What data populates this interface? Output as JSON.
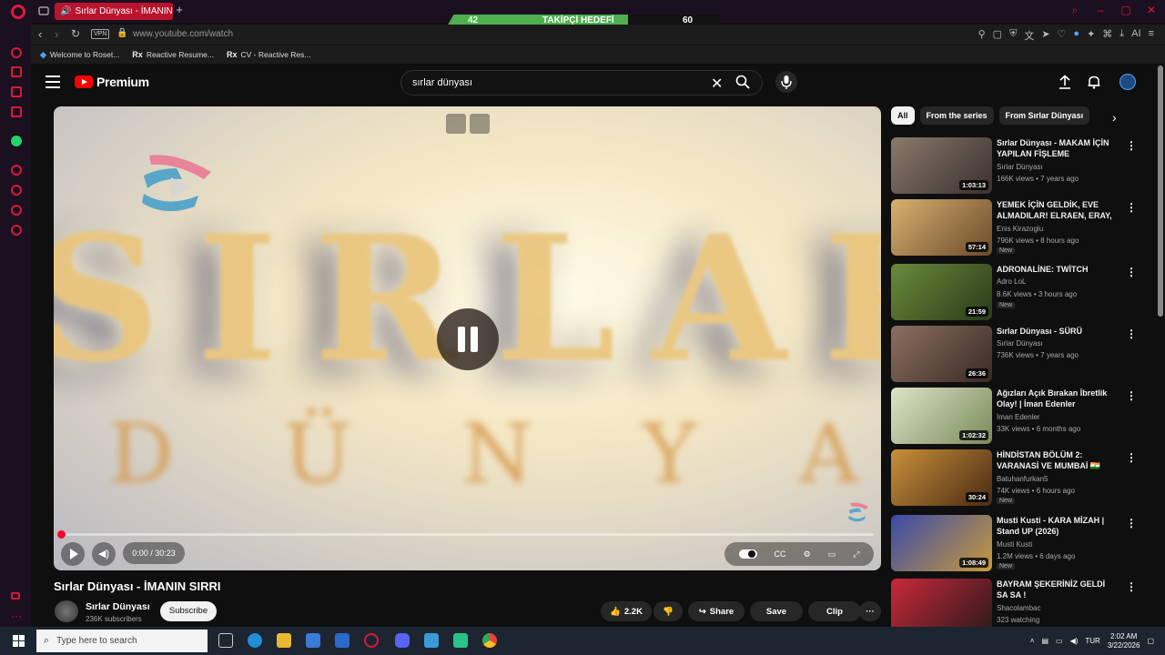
{
  "browser": {
    "tab_title": "Sırlar Dünyası - İMANIN",
    "url": "www.youtube.com/watch",
    "vpn_label": "VPN",
    "bookmarks": [
      {
        "icon": "R",
        "label": "Welcome to Roset..."
      },
      {
        "icon": "Rx",
        "label": "Reactive Resume..."
      },
      {
        "icon": "Rx",
        "label": "CV - Reactive Res..."
      }
    ],
    "accent_color": "#e0193d"
  },
  "stream_overlay": {
    "current": "42",
    "label": "TAKİPÇİ HEDEFİ",
    "target": "60",
    "bar_color": "#4fb04f"
  },
  "header": {
    "logo_text": "Premium",
    "search_value": "sırlar dünyası"
  },
  "player": {
    "time": "0:00 / 30:23",
    "progress_fraction": 0.0,
    "state": "paused",
    "art_title": "SIRLAR",
    "art_subtitle": "DÜNYA"
  },
  "video": {
    "title": "Sırlar Dünyası - İMANIN SIRRI",
    "channel": "Sırlar Dünyası",
    "subscribers": "236K subscribers",
    "subscribe_label": "Subscribe",
    "likes": "2.2K",
    "share_label": "Share",
    "save_label": "Save",
    "clip_label": "Clip"
  },
  "chips": [
    "All",
    "From the series",
    "From Sırlar Dünyası"
  ],
  "recommendations": [
    {
      "title": "Sırlar Dünyası - MAKAM İÇİN YAPILAN FİŞLEME",
      "channel": "Sırlar Dünyası",
      "meta": "166K views • 7 years ago",
      "duration": "1:03:13",
      "new": "",
      "thumb": "#5a4a40"
    },
    {
      "title": "YEMEK İÇİN GELDİK, EVE ALMADILAR! ELRAEN, ERAY, ...",
      "channel": "Enis Kirazoglu",
      "meta": "796K views • 8 hours ago",
      "duration": "57:14",
      "new": "New",
      "thumb": "#c89a4c"
    },
    {
      "title": "ADRONALİNE: TWİTCH",
      "channel": "Adro LoL",
      "meta": "8.6K views • 3 hours ago",
      "duration": "21:59",
      "new": "New",
      "thumb": "#4a6a2c"
    },
    {
      "title": "Sırlar Dünyası - SÜRÜ",
      "channel": "Sırlar Dünyası",
      "meta": "736K views • 7 years ago",
      "duration": "26:36",
      "new": "",
      "thumb": "#6e5a4a"
    },
    {
      "title": "Ağızları Açık Bırakan İbretlik Olay! | İman Edenler",
      "channel": "İman Edenler",
      "meta": "33K views • 6 months ago",
      "duration": "1:02:32",
      "new": "",
      "thumb": "#b9c2a4"
    },
    {
      "title": "HİNDİSTAN BÖLÜM 2: VARANASİ VE MUMBAİ 🇮🇳",
      "channel": "Batuhanfurkan5",
      "meta": "74K views • 6 hours ago",
      "duration": "30:24",
      "new": "New",
      "thumb": "#a8702c"
    },
    {
      "title": "Musti Kusti - KARA MİZAH | Stand UP (2026)",
      "channel": "Musti Kusti",
      "meta": "1.2M views • 6 days ago",
      "duration": "1:08:49",
      "new": "New",
      "thumb": "#2c3a8a"
    },
    {
      "title": "BAYRAM ŞEKERİNİZ GELDİ SA SA !",
      "channel": "Shacolambac",
      "meta": "323 watching",
      "duration": "",
      "new": "",
      "thumb": "#8a2c3a"
    }
  ],
  "taskbar": {
    "search_placeholder": "Type here to search",
    "language": "TUR",
    "time": "2:02 AM",
    "date": "3/22/2026"
  }
}
